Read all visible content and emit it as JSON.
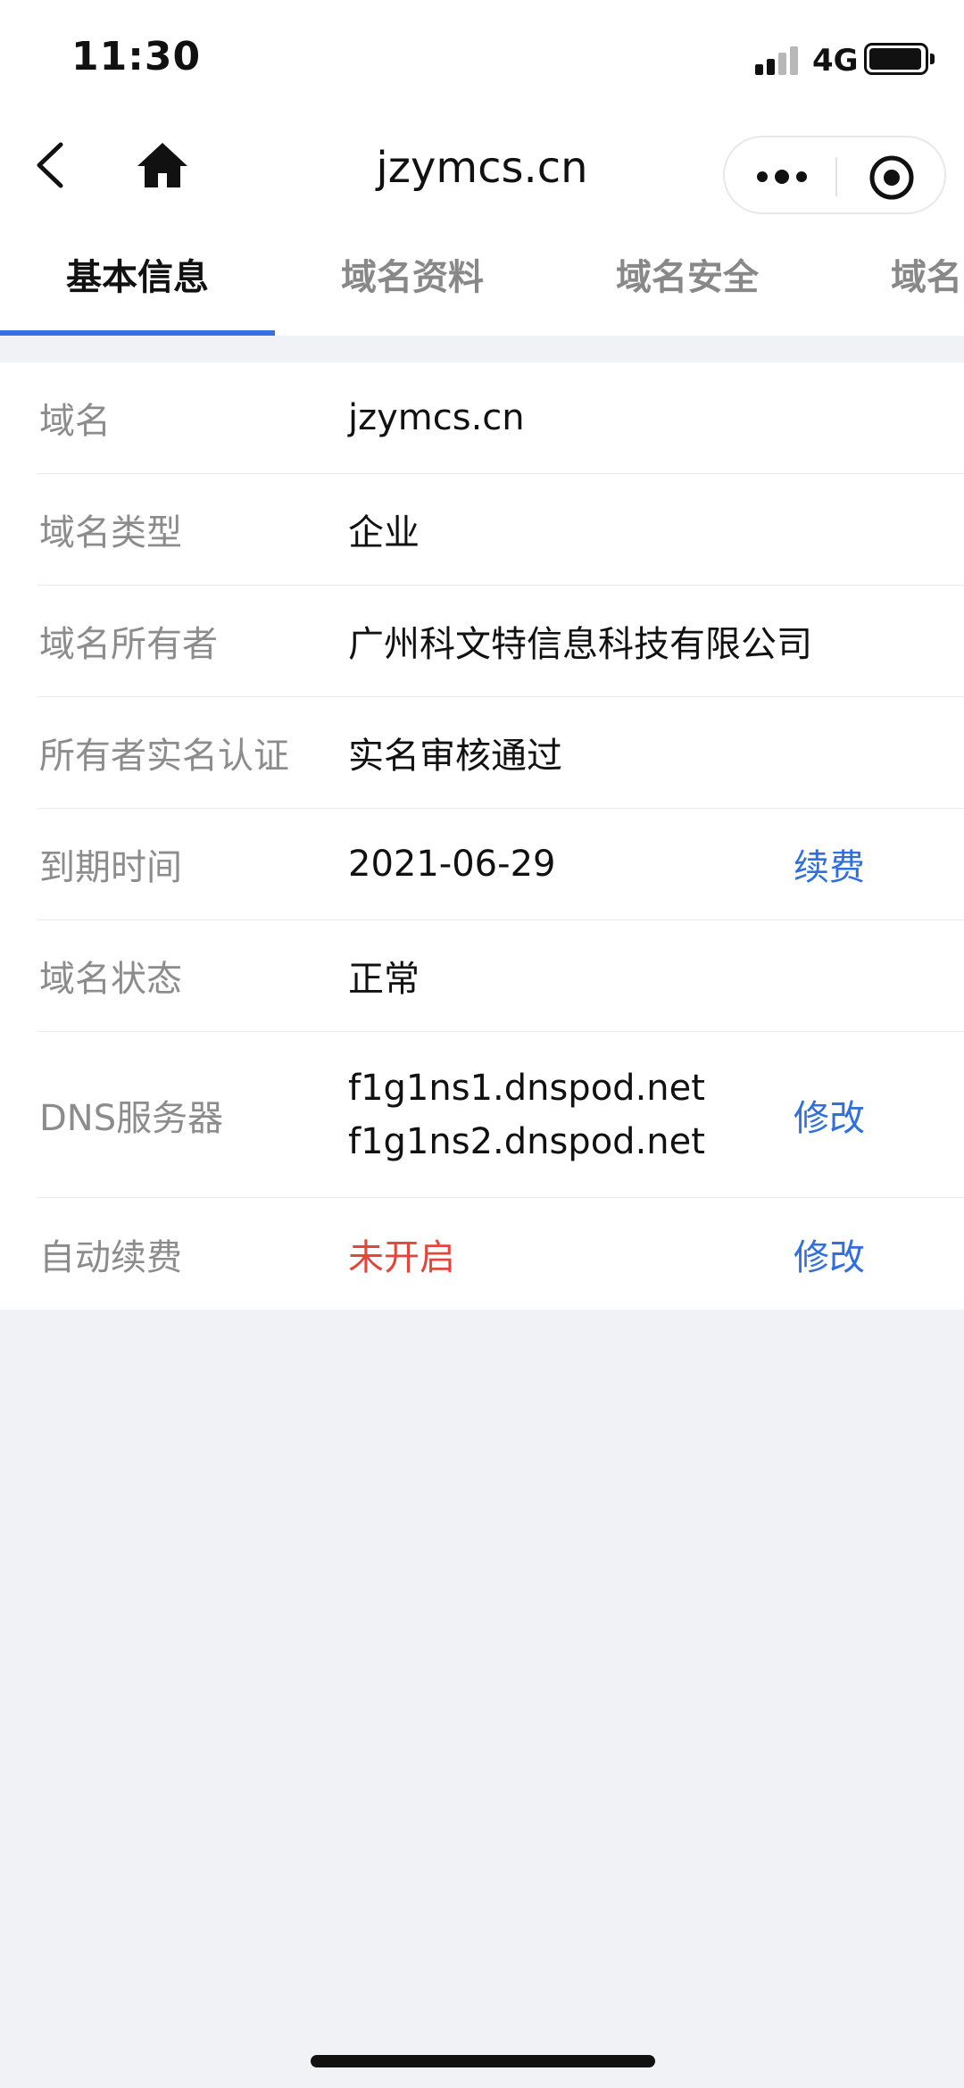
{
  "status_bar": {
    "time": "11:30",
    "network": "4G",
    "icons": [
      "signal-icon",
      "battery-icon"
    ]
  },
  "nav": {
    "title": "jzymcs.cn",
    "icons": [
      "back-icon",
      "home-icon",
      "more-icon",
      "close-icon"
    ]
  },
  "tabs": [
    {
      "label": "基本信息",
      "active": true
    },
    {
      "label": "域名资料",
      "active": false
    },
    {
      "label": "域名安全",
      "active": false
    },
    {
      "label": "域名",
      "active": false
    }
  ],
  "info": {
    "domain": {
      "label": "域名",
      "value": "jzymcs.cn"
    },
    "type": {
      "label": "域名类型",
      "value": "企业"
    },
    "owner": {
      "label": "域名所有者",
      "value": "广州科文特信息科技有限公司"
    },
    "verification": {
      "label": "所有者实名认证",
      "value": "实名审核通过"
    },
    "expiry": {
      "label": "到期时间",
      "value": "2021-06-29",
      "action": "续费"
    },
    "status": {
      "label": "域名状态",
      "value": "正常"
    },
    "dns": {
      "label": "DNS服务器",
      "values": [
        "f1g1ns1.dnspod.net",
        "f1g1ns2.dnspod.net"
      ],
      "action": "修改"
    },
    "auto_renew": {
      "label": "自动续费",
      "value": "未开启",
      "action": "修改"
    }
  },
  "colors": {
    "accent": "#2f6fe0",
    "tab_indicator": "#3a6fe1",
    "warning": "#e2473c",
    "background": "#f1f2f5"
  }
}
